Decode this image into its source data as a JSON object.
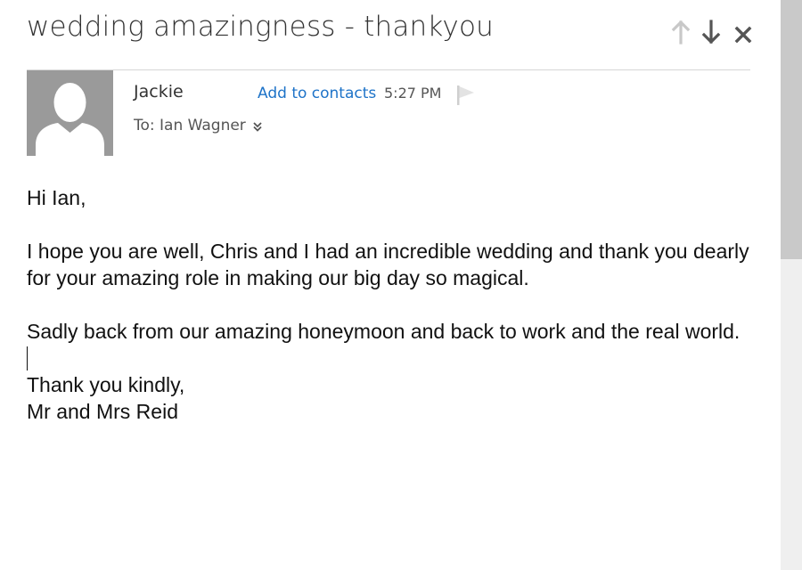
{
  "message": {
    "subject": "wedding amazingness - thankyou",
    "sender_name": "Jackie",
    "add_to_contacts": "Add to contacts",
    "time": "5:27 PM",
    "to_line": "To: Ian Wagner"
  },
  "nav": {
    "previous_icon": "arrow-up-icon",
    "next_icon": "arrow-down-icon",
    "close_icon": "close-icon"
  },
  "body": {
    "greeting": "Hi Ian,",
    "paragraph1": "I hope you are well, Chris and I had an incredible wedding and thank you dearly for your amazing role in making our big day so magical.",
    "paragraph2": "Sadly back from our amazing honeymoon and back to work and the real world.",
    "closing": "Thank you kindly,",
    "signature": "Mr and Mrs Reid"
  },
  "colors": {
    "link": "#1e73c8",
    "avatar_bg": "#9a9a9a",
    "scroll_thumb": "#c9c9c9",
    "scroll_track": "#efefef"
  }
}
